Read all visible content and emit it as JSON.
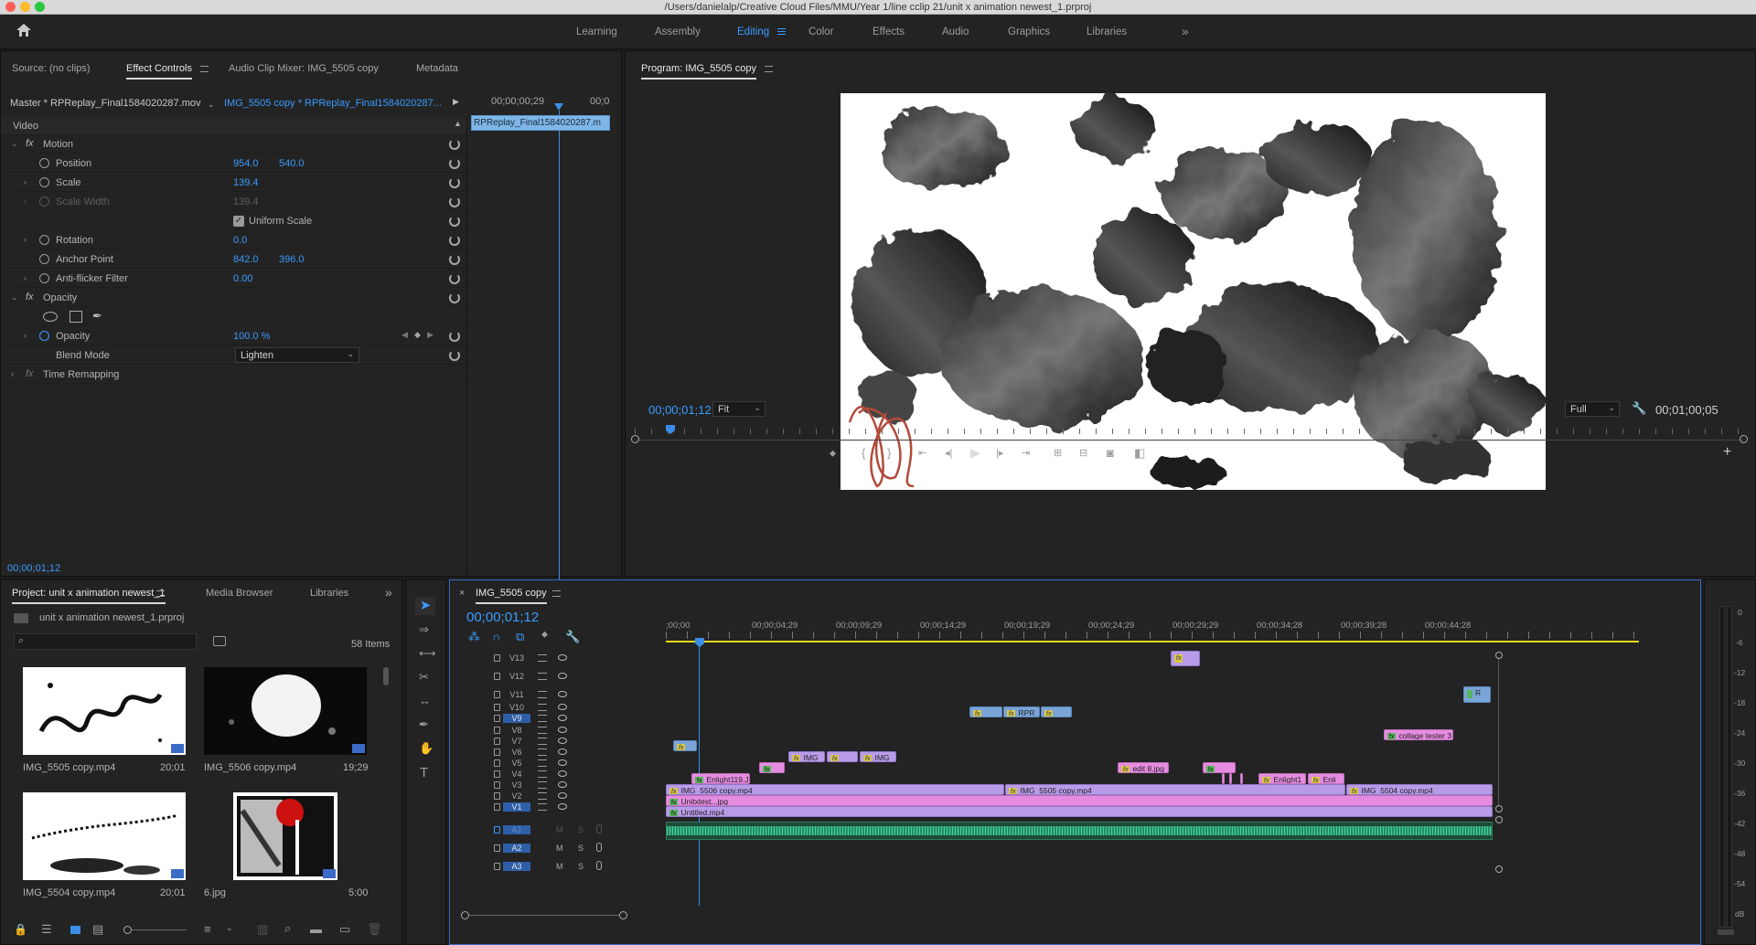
{
  "window": {
    "title": "/Users/danielalp/Creative Cloud Files/MMU/Year 1/line cclip 21/unit x animation newest_1.prproj"
  },
  "workspaces": {
    "items": [
      "Learning",
      "Assembly",
      "Editing",
      "Color",
      "Effects",
      "Audio",
      "Graphics",
      "Libraries"
    ],
    "active": "Editing",
    "more": "»"
  },
  "source_panel": {
    "tabs": [
      "Source: (no clips)",
      "Effect Controls",
      "Audio Clip Mixer: IMG_5505 copy",
      "Metadata"
    ],
    "active_tab": "Effect Controls"
  },
  "effect_controls": {
    "master": "Master * RPReplay_Final1584020287.mov",
    "clip": "IMG_5505 copy * RPReplay_Final1584020287...",
    "mini_time": "00;00;00;29",
    "mini_time2": "00;0",
    "mini_clip": "RPReplay_Final1584020287.m",
    "section": "Video",
    "motion": "Motion",
    "position": {
      "label": "Position",
      "x": "954.0",
      "y": "540.0"
    },
    "scale": {
      "label": "Scale",
      "value": "139.4"
    },
    "scale_width": {
      "label": "Scale Width",
      "value": "139.4"
    },
    "uniform": "Uniform Scale",
    "rotation": {
      "label": "Rotation",
      "value": "0.0"
    },
    "anchor": {
      "label": "Anchor Point",
      "x": "842.0",
      "y": "396.0"
    },
    "antiflicker": {
      "label": "Anti-flicker Filter",
      "value": "0.00"
    },
    "opacity_section": "Opacity",
    "opacity": {
      "label": "Opacity",
      "value": "100.0 %"
    },
    "blend": {
      "label": "Blend Mode",
      "value": "Lighten"
    },
    "time_remap": "Time Remapping",
    "timecode": "00;00;01;12"
  },
  "program": {
    "title": "Program: IMG_5505 copy",
    "timecode": "00;00;01;12",
    "fit": "Fit",
    "quality": "Full",
    "duration": "00;01;00;05"
  },
  "project": {
    "tabs": [
      "Project: unit x animation newest_1",
      "Media Browser",
      "Libraries"
    ],
    "file": "unit x animation newest_1.prproj",
    "items_count": "58 Items",
    "media": [
      {
        "name": "IMG_5505 copy.mp4",
        "dur": "20;01"
      },
      {
        "name": "IMG_5506 copy.mp4",
        "dur": "19;29"
      },
      {
        "name": "IMG_5504 copy.mp4",
        "dur": "20;01"
      },
      {
        "name": "6.jpg",
        "dur": "5:00"
      }
    ]
  },
  "timeline": {
    "title": "IMG_5505 copy",
    "timecode": "00;00;01;12",
    "ruler": [
      ";00;00",
      "00;00;04;29",
      "00;00;09;29",
      "00;00;14;29",
      "00;00;19;29",
      "00;00;24;29",
      "00;00;29;29",
      "00;00;34;28",
      "00;00;39;28",
      "00;00;44;28"
    ],
    "video_tracks": [
      "V13",
      "V12",
      "V11",
      "V10",
      "V9",
      "V8",
      "V7",
      "V6",
      "V5",
      "V4",
      "V3",
      "V2",
      "V1"
    ],
    "audio_tracks": [
      "A1",
      "A2",
      "A3"
    ],
    "clip_labels": {
      "rpr": "RPR",
      "img": "IMG",
      "collage": "collage tester 3",
      "edit8": "edit 8.jpg",
      "enlight119": "Enlight119.J",
      "enlight1": "Enlight1",
      "enli": "Enli",
      "img5506": "IMG_5506 copy.mp4",
      "img5505": "IMG_5505 copy.mp4",
      "img5504": "IMG_5504 copy.mp4",
      "unixtest": "Unitxtest...jpg",
      "untitled": "Untitled.mp4",
      "r": "R"
    },
    "ms": [
      "M",
      "S"
    ]
  },
  "meter": {
    "labels": [
      "0",
      "-6",
      "-12",
      "-18",
      "-24",
      "-30",
      "-36",
      "-42",
      "-48",
      "-54",
      "dB"
    ]
  }
}
